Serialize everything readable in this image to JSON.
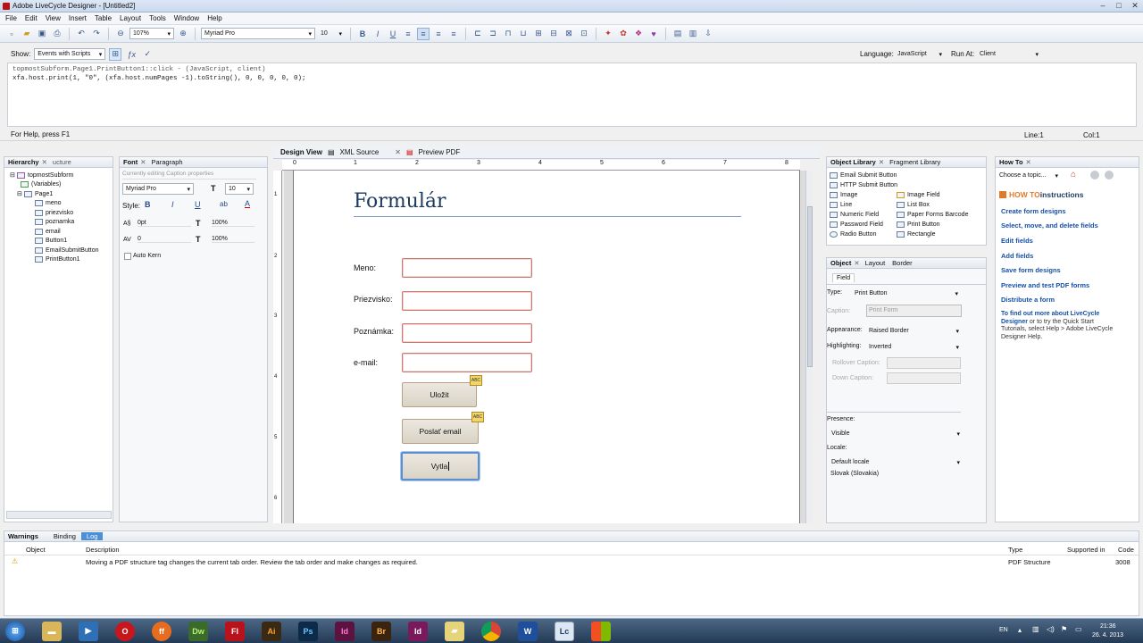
{
  "window": {
    "title": "Adobe LiveCycle Designer - [Untitled2]"
  },
  "menu": [
    "File",
    "Edit",
    "View",
    "Insert",
    "Table",
    "Layout",
    "Tools",
    "Window",
    "Help"
  ],
  "toolbar": {
    "zoom": "107%",
    "font": "Myriad Pro",
    "font_size": "10"
  },
  "scriptbar": {
    "show_label": "Show:",
    "show_value": "Events with Scripts",
    "language_label": "Language:",
    "language_value": "JavaScript",
    "runat_label": "Run At:",
    "runat_value": "Client"
  },
  "script": {
    "line1": "  topmostSubform.Page1.PrintButton1::click - (JavaScript, client)",
    "line2": "xfa.host.print(1, \"0\", (xfa.host.numPages -1).toString(), 0, 0, 0, 0, 0);"
  },
  "status": {
    "help": "For Help, press F1",
    "line": "Line:1",
    "col": "Col:1"
  },
  "hierarchy": {
    "tab": "Hierarchy",
    "tab2": "ucture",
    "items": [
      "topmostSubform",
      "(Variables)",
      "Page1",
      "meno",
      "priezvisko",
      "poznamka",
      "email",
      "Button1",
      "EmailSubmitButton",
      "PrintButton1"
    ]
  },
  "font_panel": {
    "tab": "Font",
    "tab2": "Paragraph",
    "hint": "Currently editing Caption properties",
    "font": "Myriad Pro",
    "size": "10",
    "style_label": "Style:",
    "baseline": "0pt",
    "vscale": "100%",
    "kerning": "0",
    "hscale": "100%",
    "auto_kern": "Auto Kern"
  },
  "design": {
    "tabs": [
      "Design View",
      "XML Source",
      "Preview PDF"
    ],
    "ruler": [
      "0",
      "1",
      "2",
      "3",
      "4",
      "5",
      "6",
      "7",
      "8"
    ],
    "vruler": [
      "1",
      "2",
      "3",
      "4",
      "5",
      "6"
    ],
    "title": "Formulár",
    "labels": [
      "Meno:",
      "Priezvisko:",
      "Poznámka:",
      "e-mail:"
    ],
    "buttons": {
      "save": "Uložit",
      "email": "Poslať email",
      "print": "Vytla"
    },
    "badge": "ABC"
  },
  "object_library": {
    "tab": "Object Library",
    "tab2": "Fragment Library",
    "items_left": [
      "Email Submit Button",
      "HTTP Submit Button",
      "Image",
      "Line",
      "Numeric Field",
      "Password Field",
      "Radio Button"
    ],
    "items_right": [
      "Image Field",
      "List Box",
      "Paper Forms Barcode",
      "Print Button",
      "Rectangle"
    ]
  },
  "object": {
    "tabs": [
      "Object",
      "Layout",
      "Border"
    ],
    "subtab": "Field",
    "type_label": "Type:",
    "type_value": "Print Button",
    "caption_label": "Caption:",
    "caption_value": "Print Form",
    "appearance_label": "Appearance:",
    "appearance_value": "Raised Border",
    "highlighting_label": "Highlighting:",
    "highlighting_value": "Inverted",
    "rollover_label": "Rollover Caption:",
    "down_label": "Down Caption:",
    "presence_label": "Presence:",
    "presence_value": "Visible",
    "locale_label": "Locale:",
    "locale_value": "Default locale",
    "locale_sub": "Slovak (Slovakia)"
  },
  "howto": {
    "tab": "How To",
    "choose": "Choose a topic...",
    "header_prefix": "HOW TO",
    "header_rest": " instructions",
    "links": [
      "Create form designs",
      "Select, move, and delete fields",
      "Edit fields",
      "Add fields",
      "Save form designs",
      "Preview and test PDF forms",
      "Distribute a form"
    ],
    "footer_a": "To find out more about LiveCycle Designer",
    "footer_b": " or to try the Quick Start Tutorials, select Help > Adobe LiveCycle Designer Help."
  },
  "warnings": {
    "tabs": [
      "Warnings",
      "Binding",
      "Log"
    ],
    "cols": [
      "Object",
      "Description",
      "Type",
      "Supported in",
      "Code"
    ],
    "row": {
      "desc": "Moving a PDF structure tag changes the current tab order. Review the tab order and make changes as required.",
      "type": "PDF Structure",
      "code": "3008"
    }
  },
  "taskbar": {
    "lang": "EN",
    "time": "21:36",
    "date": "26. 4. 2013",
    "apps": [
      "Dw",
      "Fl",
      "Ai",
      "Ps",
      "Id",
      "Br",
      "Id",
      "W",
      "Lc"
    ]
  }
}
